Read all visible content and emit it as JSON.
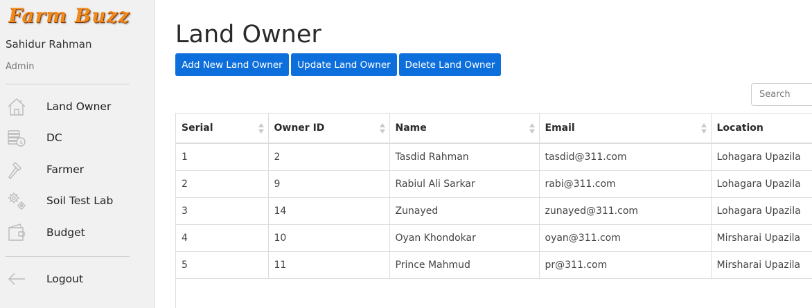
{
  "brand": {
    "logo_text": "Farm Buzz"
  },
  "user": {
    "name": "Sahidur Rahman",
    "role": "Admin"
  },
  "sidebar": {
    "items": [
      {
        "label": "Land Owner",
        "icon": "house-icon"
      },
      {
        "label": "DC",
        "icon": "coins-icon"
      },
      {
        "label": "Farmer",
        "icon": "hammer-icon"
      },
      {
        "label": "Soil Test Lab",
        "icon": "gears-icon"
      },
      {
        "label": "Budget",
        "icon": "wallet-icon"
      }
    ],
    "logout": {
      "label": "Logout",
      "icon": "arrow-left-icon"
    }
  },
  "main": {
    "title": "Land Owner",
    "buttons": {
      "add": "Add New Land Owner",
      "update": "Update Land Owner",
      "delete": "Delete Land Owner"
    },
    "search": {
      "placeholder": "Search",
      "value": ""
    },
    "table": {
      "headers": [
        "Serial",
        "Owner ID",
        "Name",
        "Email",
        "Location"
      ],
      "rows": [
        [
          "1",
          "2",
          "Tasdid Rahman",
          "tasdid@311.com",
          "Lohagara Upazila"
        ],
        [
          "2",
          "9",
          "Rabiul Ali Sarkar",
          "rabi@311.com",
          "Lohagara Upazila"
        ],
        [
          "3",
          "14",
          "Zunayed",
          "zunayed@311.com",
          "Lohagara Upazila"
        ],
        [
          "4",
          "10",
          "Oyan Khondokar",
          "oyan@311.com",
          "Mirsharai Upazila"
        ],
        [
          "5",
          "11",
          "Prince Mahmud",
          "pr@311.com",
          "Mirsharai Upazila"
        ]
      ]
    }
  },
  "colors": {
    "primary": "#0d6fdc",
    "sidebar_bg": "#f1f1f1",
    "logo": "#f08a1e"
  }
}
